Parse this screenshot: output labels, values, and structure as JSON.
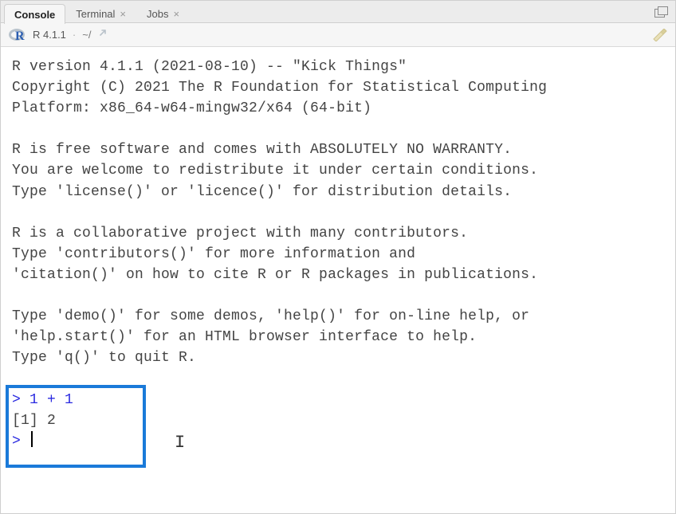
{
  "tabs": {
    "console": "Console",
    "terminal": "Terminal",
    "jobs": "Jobs"
  },
  "infobar": {
    "version": "R 4.1.1",
    "sep": "·",
    "wd": "~/"
  },
  "console": {
    "banner": "R version 4.1.1 (2021-08-10) -- \"Kick Things\"\nCopyright (C) 2021 The R Foundation for Statistical Computing\nPlatform: x86_64-w64-mingw32/x64 (64-bit)\n\nR is free software and comes with ABSOLUTELY NO WARRANTY.\nYou are welcome to redistribute it under certain conditions.\nType 'license()' or 'licence()' for distribution details.\n\nR is a collaborative project with many contributors.\nType 'contributors()' for more information and\n'citation()' on how to cite R or R packages in publications.\n\nType 'demo()' for some demos, 'help()' for on-line help, or\n'help.start()' for an HTML browser interface to help.\nType 'q()' to quit R.\n",
    "prompt1": "> ",
    "input1": "1 + 1",
    "output1": "[1] 2",
    "prompt2": "> "
  },
  "icons": {
    "close": "×",
    "share": "↗"
  }
}
